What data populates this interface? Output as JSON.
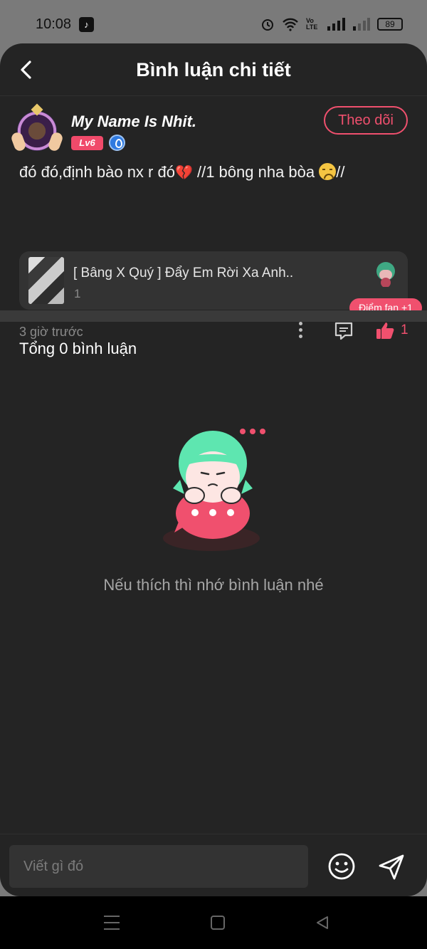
{
  "status_bar": {
    "time": "10:08",
    "battery": "89",
    "network": "Vo LTE"
  },
  "header": {
    "title": "Bình luận chi tiết",
    "back_icon": "chevron-left-icon"
  },
  "post": {
    "username": "My Name Is Nhit.",
    "level": "Lv6",
    "follow_label": "Theo dõi",
    "text_part1": "đó đó,định bào nx r đó",
    "text_part2": " //1 bông nha bòa ",
    "text_part3": "//",
    "song": {
      "title": "[ Bâng X Quý ] Đẩy Em Rời Xa Anh..",
      "count": "1"
    },
    "fan_badge": "Điểm fan +1",
    "time_ago": "3 giờ trước",
    "like_count": "1"
  },
  "comments": {
    "total_label": "Tổng 0 bình luận",
    "empty_text": "Nếu thích thì nhớ bình luận nhé"
  },
  "input": {
    "placeholder": "Viết gì đó"
  },
  "colors": {
    "accent": "#f0506e",
    "background": "#242424",
    "card": "#333333",
    "mascot_hair": "#5ee6b0"
  }
}
